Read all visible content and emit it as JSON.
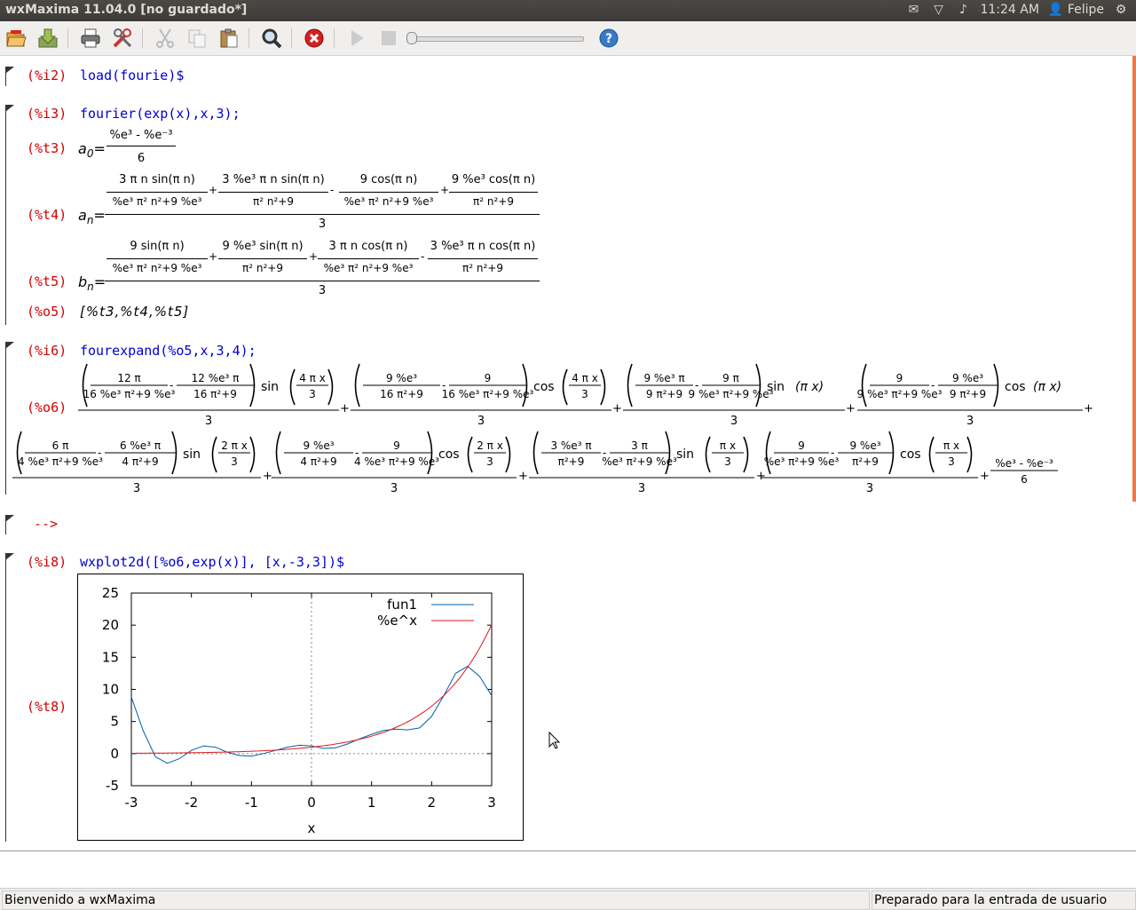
{
  "window": {
    "title": "wxMaxima 11.04.0 [no guardado*]"
  },
  "tray": {
    "time": "11:24 AM",
    "user": "Felipe"
  },
  "toolbar": {
    "icons": [
      "open-icon",
      "save-icon",
      "print-icon",
      "preferences-icon",
      "cut-icon",
      "copy-icon",
      "paste-icon",
      "find-icon",
      "interrupt-icon",
      "play-icon",
      "stop-icon",
      "animation-slider",
      "help-icon"
    ]
  },
  "cells": {
    "i2": {
      "label": "(%i2)",
      "input": "load(fourie)$"
    },
    "i3": {
      "label": "(%i3)",
      "input": "fourier(exp(x),x,3);"
    },
    "t3": {
      "label": "(%t3)",
      "lhs": "a",
      "sub": "0"
    },
    "t4": {
      "label": "(%t4)",
      "lhs": "a",
      "sub": "n"
    },
    "t5": {
      "label": "(%t5)",
      "lhs": "b",
      "sub": "n"
    },
    "o5": {
      "label": "(%o5)",
      "output": "[%t3,%t4,%t5]"
    },
    "i6": {
      "label": "(%i6)",
      "input": "fourexpand(%o5,x,3,4);"
    },
    "o6": {
      "label": "(%o6)"
    },
    "prompt": {
      "label": "-->"
    },
    "i8": {
      "label": "(%i8)",
      "input": "wxplot2d([%o6,exp(x)], [x,-3,3])$"
    },
    "t8": {
      "label": "(%t8)"
    }
  },
  "math": {
    "eminus": "%e",
    "t3_num": "%e³ - %e⁻³",
    "den3": "3",
    "den6": "6",
    "t4_terms": [
      {
        "num": "3 π n sin(π n)",
        "den": "%e³ π² n²+9 %e³"
      },
      {
        "num": "3 %e³ π n sin(π n)",
        "den": "π² n²+9"
      },
      {
        "num": "9 cos(π n)",
        "den": "%e³ π² n²+9 %e³"
      },
      {
        "num": "9 %e³ cos(π n)",
        "den": "π² n²+9"
      }
    ],
    "t5_terms": [
      {
        "num": "9 sin(π n)",
        "den": "%e³ π² n²+9 %e³"
      },
      {
        "num": "9 %e³ sin(π n)",
        "den": "π² n²+9"
      },
      {
        "num": "3 π n cos(π n)",
        "den": "%e³ π² n²+9 %e³"
      },
      {
        "num": "3 %e³ π n cos(π n)",
        "den": "π² n²+9"
      }
    ],
    "o6_row1": [
      {
        "a_num": "12 π",
        "a_den": "16 %e³ π²+9 %e³",
        "b_num": "12 %e³ π",
        "b_den": "16 π²+9",
        "fn": "sin",
        "arg_num": "4 π x",
        "arg_den": "3"
      },
      {
        "a_num": "9 %e³",
        "a_den": "16 π²+9",
        "b_num": "9",
        "b_den": "16 %e³ π²+9 %e³",
        "fn": "cos",
        "arg_num": "4 π x",
        "arg_den": "3"
      },
      {
        "a_num": "9 %e³ π",
        "a_den": "9 π²+9",
        "b_num": "9 π",
        "b_den": "9 %e³ π²+9 %e³",
        "fn": "sin",
        "arg": "π x"
      },
      {
        "a_num": "9",
        "a_den": "9 %e³ π²+9 %e³",
        "b_num": "9 %e³",
        "b_den": "9 π²+9",
        "fn": "cos",
        "arg": "π x"
      }
    ],
    "o6_row2": [
      {
        "a_num": "6 π",
        "a_den": "4 %e³ π²+9 %e³",
        "b_num": "6 %e³ π",
        "b_den": "4 π²+9",
        "fn": "sin",
        "arg_num": "2 π x",
        "arg_den": "3"
      },
      {
        "a_num": "9 %e³",
        "a_den": "4 π²+9",
        "b_num": "9",
        "b_den": "4 %e³ π²+9 %e³",
        "fn": "cos",
        "arg_num": "2 π x",
        "arg_den": "3"
      },
      {
        "a_num": "3 %e³ π",
        "a_den": "π²+9",
        "b_num": "3 π",
        "b_den": "%e³ π²+9 %e³",
        "fn": "sin",
        "arg_num": "π x",
        "arg_den": "3"
      },
      {
        "a_num": "9",
        "a_den": "%e³ π²+9 %e³",
        "b_num": "9 %e³",
        "b_den": "π²+9",
        "fn": "cos",
        "arg_num": "π x",
        "arg_den": "3"
      }
    ]
  },
  "chart_data": {
    "type": "line",
    "xlabel": "x",
    "xlim": [
      -3,
      3
    ],
    "ylim": [
      -5,
      25
    ],
    "xticks": [
      "-3",
      "-2",
      "-1",
      "0",
      "1",
      "2",
      "3"
    ],
    "yticks": [
      "-5",
      "0",
      "5",
      "10",
      "15",
      "20",
      "25"
    ],
    "legend_position": "top-right",
    "series": [
      {
        "name": "fun1",
        "color": "#0060ad",
        "x": [
          -3,
          -2.8,
          -2.6,
          -2.4,
          -2.2,
          -2.0,
          -1.8,
          -1.6,
          -1.4,
          -1.2,
          -1.0,
          -0.8,
          -0.6,
          -0.4,
          -0.2,
          0,
          0.2,
          0.4,
          0.6,
          0.8,
          1.0,
          1.2,
          1.4,
          1.6,
          1.8,
          2.0,
          2.2,
          2.4,
          2.6,
          2.8,
          3.0
        ],
        "y": [
          8.8,
          3.5,
          -0.5,
          -1.5,
          -0.8,
          0.5,
          1.2,
          1.0,
          0.2,
          -0.3,
          -0.4,
          0.0,
          0.5,
          1.0,
          1.3,
          1.2,
          0.8,
          0.9,
          1.5,
          2.3,
          3.0,
          3.6,
          3.8,
          3.7,
          4.0,
          5.8,
          9.0,
          12.5,
          13.6,
          12.0,
          9.0
        ]
      },
      {
        "name": "%e^x",
        "color": "#dd181f",
        "formula": "exp(x)"
      }
    ]
  },
  "status": {
    "left": "Bienvenido a wxMaxima",
    "right": "Preparado para la entrada de usuario"
  },
  "colors": {
    "prompt_label": "#d20000",
    "input_text": "#0000d0",
    "titlebar": "#3c3b37",
    "scroll_thumb": "#f07746"
  }
}
